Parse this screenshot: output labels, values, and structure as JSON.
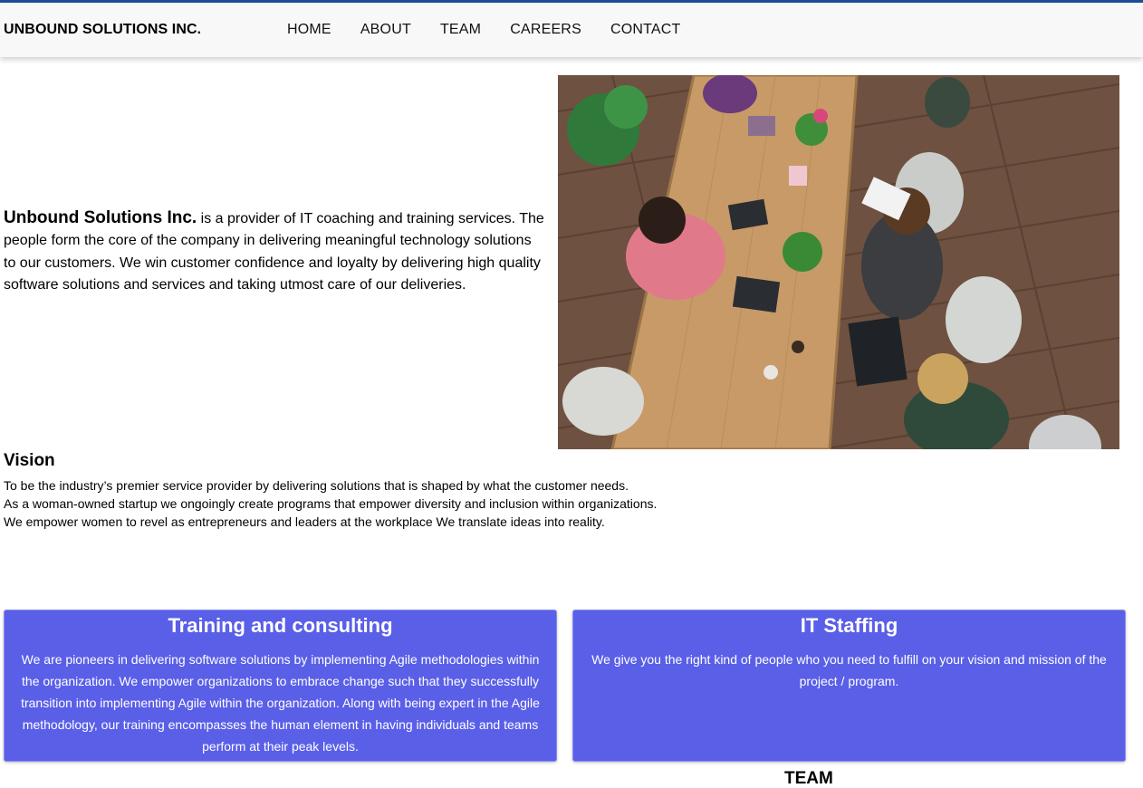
{
  "header": {
    "brand": "UNBOUND SOLUTIONS INC.",
    "nav": [
      {
        "label": "HOME"
      },
      {
        "label": "ABOUT"
      },
      {
        "label": "TEAM"
      },
      {
        "label": "CAREERS"
      },
      {
        "label": "CONTACT"
      }
    ]
  },
  "intro": {
    "company": "Unbound Solutions Inc.",
    "text": " is a provider of IT coaching and training services. The people form the core of the company in delivering meaningful technology solutions to our customers. We win customer confidence and loyalty by delivering high quality software solutions and services and taking utmost care of our deliveries."
  },
  "vision": {
    "title": "Vision",
    "lines": [
      "To be the industry’s premier service provider by delivering solutions that is shaped by what the customer needs.",
      "As a woman-owned startup we ongoingly create programs that empower diversity and inclusion within organizations.",
      "We empower women to revel as entrepreneurs and leaders at the workplace We translate ideas into reality."
    ]
  },
  "services": [
    {
      "title": "Training and consulting",
      "text": "We are pioneers in delivering software solutions by implementing Agile methodologies within the organization. We empower organizations to embrace change such that they successfully transition into implementing Agile within the organization. Along with being expert in the Agile methodology, our training encompasses the human element in having individuals and teams perform at their peak levels."
    },
    {
      "title": "IT Staffing",
      "text": "We give you the right kind of people who you need to fulfill on your vision and mission of the project / program."
    }
  ],
  "team": {
    "heading": "TEAM"
  },
  "colors": {
    "accent_bar": "#1f4e99",
    "card_background": "#5a5fe8"
  }
}
